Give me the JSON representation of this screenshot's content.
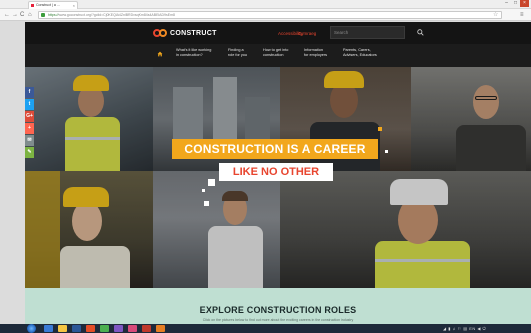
{
  "browser": {
    "tab_title": "Construct | a ...",
    "tab_close": "×",
    "window_controls": [
      "–",
      "□",
      "×"
    ],
    "nav_buttons": [
      "←",
      "→",
      "C",
      "⌂"
    ],
    "url_scheme": "https://",
    "url_rest": "www.goconstruct.org/?gclid=Cj0KEQiA4ZnlBRDvsqKm84s4ABEiAD9sEm8",
    "star": "☆",
    "menu": "≡"
  },
  "site": {
    "logo_text": "CONSTRUCT",
    "accessibility": "Accessibility",
    "cymraeg": "Cymraeg",
    "search_placeholder": "Search",
    "menu_items": [
      {
        "line1": "What's it like working",
        "line2": "in construction?"
      },
      {
        "line1": "Finding a",
        "line2": "role for you"
      },
      {
        "line1": "How to get into",
        "line2": "construction"
      },
      {
        "line1": "Information",
        "line2": "for employers"
      },
      {
        "line1": "Parents, Carers,",
        "line2": "Advisers, Educators"
      }
    ]
  },
  "hero": {
    "headline": "CONSTRUCTION IS A CAREER",
    "subheadline": "LIKE NO OTHER"
  },
  "social": {
    "items": [
      {
        "label": "f",
        "icon": "facebook-icon",
        "color": "#3b5998"
      },
      {
        "label": "t",
        "icon": "twitter-icon",
        "color": "#1da1f2"
      },
      {
        "label": "G+",
        "icon": "google-plus-icon",
        "color": "#dd4b39"
      },
      {
        "label": "+",
        "icon": "share-plus-icon",
        "color": "#ff6550"
      },
      {
        "label": "✉",
        "icon": "email-icon",
        "color": "#7f8c8d"
      },
      {
        "label": "✎",
        "icon": "comment-icon",
        "color": "#7cb342"
      }
    ]
  },
  "explore": {
    "title": "EXPLORE CONSTRUCTION ROLES",
    "subtitle": "Click on the pictures below to find out more about the exciting careers in the construction industry"
  },
  "taskbar": {
    "tray_text": "◢ ▮ ♫ ⚐ ▤ EN ◀ ⏻"
  },
  "colors": {
    "brand_orange": "#f2a71c",
    "brand_red": "#e8452f",
    "header_bg": "#151515",
    "explore_bg": "#bfdfd2"
  }
}
